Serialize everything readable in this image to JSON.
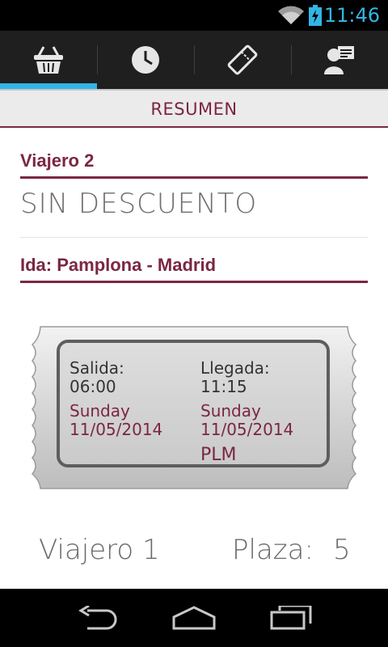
{
  "status_bar": {
    "time": "11:46",
    "icons": [
      "wifi-icon",
      "battery-charging-icon"
    ],
    "accent": "#33b5e5"
  },
  "tabs": [
    {
      "icon": "basket-icon",
      "active": true
    },
    {
      "icon": "clock-icon",
      "active": false
    },
    {
      "icon": "ticket-icon",
      "active": false
    },
    {
      "icon": "contacts-card-icon",
      "active": false
    }
  ],
  "section": {
    "title": "RESUMEN"
  },
  "traveler": {
    "heading": "Viajero 2",
    "discount": "SIN DESCUENTO"
  },
  "trip": {
    "heading": "Ida: Pamplona - Madrid",
    "departure_label": "Salida:",
    "departure_time": "06:00",
    "departure_day": "Sunday",
    "departure_date": "11/05/2014",
    "arrival_label": "Llegada:",
    "arrival_time": "11:15",
    "arrival_day": "Sunday",
    "arrival_date": "11/05/2014",
    "code": "PLM"
  },
  "seat": {
    "traveler_label": "Viajero 1",
    "seat_label": "Plaza:",
    "seat_number": "5"
  },
  "colors": {
    "brand": "#7b2642",
    "accent": "#33b5e5"
  },
  "nav_bar": {
    "buttons": [
      "back-icon",
      "home-icon",
      "recent-apps-icon"
    ]
  }
}
